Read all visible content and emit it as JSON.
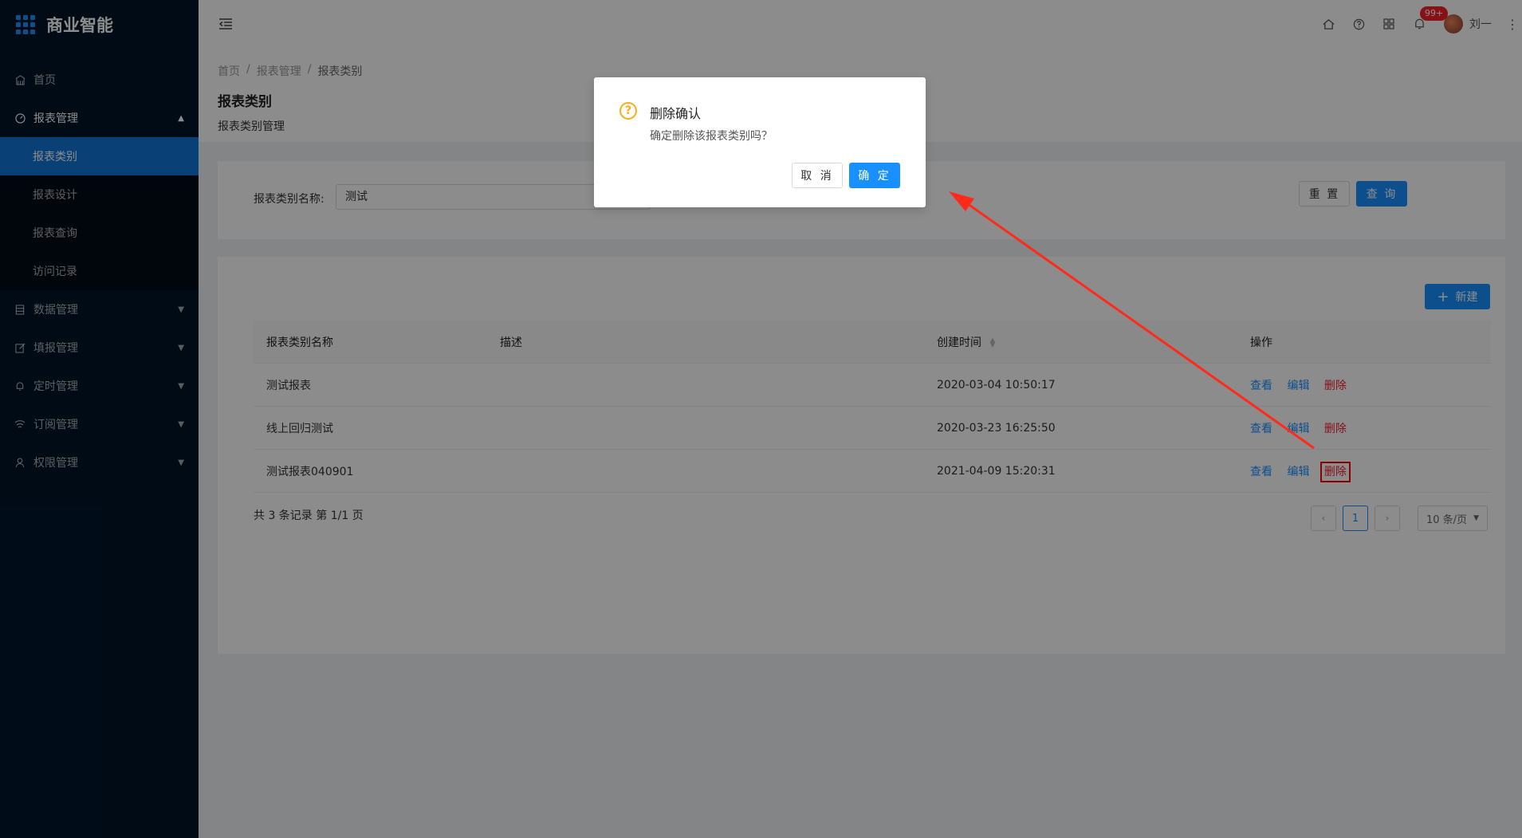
{
  "app": {
    "title": "商业智能"
  },
  "sidebar": {
    "items": [
      {
        "label": "首页",
        "icon": "home-icon"
      },
      {
        "label": "报表管理",
        "icon": "dashboard-icon",
        "expanded": true,
        "children": [
          "报表类别",
          "报表设计",
          "报表查询",
          "访问记录"
        ],
        "active_child": "报表类别"
      },
      {
        "label": "数据管理",
        "icon": "database-icon"
      },
      {
        "label": "填报管理",
        "icon": "edit-icon"
      },
      {
        "label": "定时管理",
        "icon": "bell-icon"
      },
      {
        "label": "订阅管理",
        "icon": "wifi-icon"
      },
      {
        "label": "权限管理",
        "icon": "user-icon"
      }
    ]
  },
  "header": {
    "notifications": "99+",
    "user_name": "刘一"
  },
  "breadcrumb": [
    "首页",
    "报表管理",
    "报表类别"
  ],
  "page": {
    "title": "报表类别",
    "description": "报表类别管理"
  },
  "search": {
    "label": "报表类别名称:",
    "value": "测试",
    "reset_label": "重 置",
    "query_label": "查 询"
  },
  "table": {
    "new_label": "新建",
    "columns": [
      "报表类别名称",
      "描述",
      "创建时间",
      "操作"
    ],
    "rows": [
      {
        "name": "测试报表",
        "desc": "",
        "created": "2020-03-04 10:50:17"
      },
      {
        "name": "线上回归测试",
        "desc": "",
        "created": "2020-03-23 16:25:50"
      },
      {
        "name": "测试报表040901",
        "desc": "",
        "created": "2021-04-09 15:20:31"
      }
    ],
    "actions": [
      "查看",
      "编辑",
      "删除"
    ],
    "total_text": "共 3 条记录 第 1/1 页",
    "current_page": "1",
    "page_size": "10 条/页"
  },
  "modal": {
    "title": "删除确认",
    "content": "确定删除该报表类别吗？",
    "cancel_label": "取 消",
    "ok_label": "确 定"
  },
  "colors": {
    "accent": "#1890ff",
    "danger": "#f5222d",
    "sidebar": "#001529",
    "warning": "#faad14"
  }
}
